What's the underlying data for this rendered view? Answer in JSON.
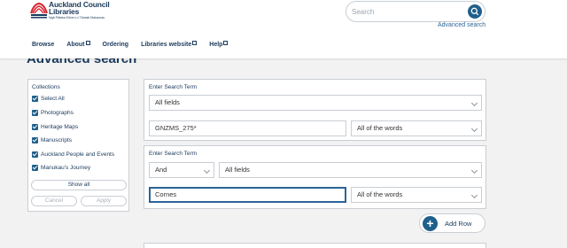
{
  "header": {
    "brand_line1": "Auckland Council",
    "brand_line2": "Libraries",
    "brand_sub": "Ngā Pātaka Kōrero o Tāmaki Makaurau",
    "search_placeholder": "Search",
    "advanced_search_link": "Advanced search"
  },
  "nav": {
    "items": [
      {
        "label": "Browse"
      },
      {
        "label": "About"
      },
      {
        "label": "Ordering"
      },
      {
        "label": "Libraries website"
      },
      {
        "label": "Help"
      }
    ]
  },
  "page": {
    "title": "Advanced search"
  },
  "collections": {
    "heading": "Collections",
    "items": [
      {
        "label": "Select All",
        "checked": true
      },
      {
        "label": "Photographs",
        "checked": true
      },
      {
        "label": "Heritage Maps",
        "checked": true
      },
      {
        "label": "Manuscripts",
        "checked": true
      },
      {
        "label": "Auckland People and Events",
        "checked": true
      },
      {
        "label": "Manukau's Journey",
        "checked": true
      }
    ],
    "show_all": "Show all",
    "cancel": "Cancel",
    "apply": "Apply"
  },
  "search_terms": [
    {
      "label": "Enter Search Term",
      "field_select": "All fields",
      "query": "GNZMS_275*",
      "match_select": "All of the words"
    },
    {
      "label": "Enter Search Term",
      "operator": "And",
      "field_select": "All fields",
      "query": "Cornes",
      "match_select": "All of the words"
    }
  ],
  "add_row": "Add Row",
  "colors": {
    "primary": "#1f5f8b",
    "text": "#1b3a5c",
    "link": "#2a6496"
  },
  "icons": [
    "auckland-council-logo",
    "search-icon",
    "external-link-icon",
    "checkbox-checked-icon",
    "chevron-down-icon",
    "plus-icon"
  ]
}
